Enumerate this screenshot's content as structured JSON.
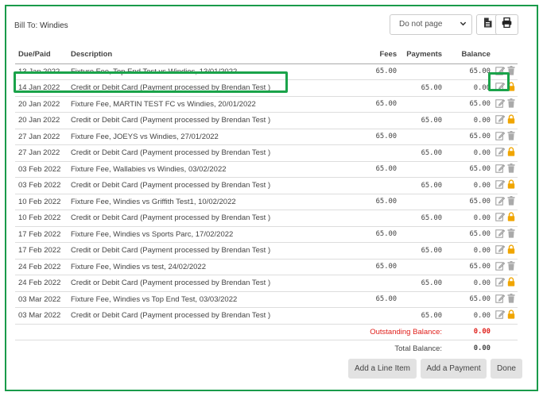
{
  "bill_to": {
    "label": "Bill To:",
    "value": "Windies"
  },
  "paging": {
    "selected": "Do not page"
  },
  "toolbar": {
    "doc_icon": "document-icon",
    "print_icon": "print-icon"
  },
  "table": {
    "headers": {
      "due_paid": "Due/Paid",
      "description": "Description",
      "fees": "Fees",
      "payments": "Payments",
      "balance": "Balance"
    },
    "rows": [
      {
        "date": "13 Jan 2022",
        "description": "Fixture Fee, Top End Test vs Windies, 13/01/2022",
        "fees": "65.00",
        "payments": "",
        "balance": "65.00",
        "type": "fee"
      },
      {
        "date": "14 Jan 2022",
        "description": "Credit or Debit Card (Payment processed by Brendan Test )",
        "fees": "",
        "payments": "65.00",
        "balance": "0.00",
        "type": "payment"
      },
      {
        "date": "20 Jan 2022",
        "description": "Fixture Fee, MARTIN TEST FC vs Windies, 20/01/2022",
        "fees": "65.00",
        "payments": "",
        "balance": "65.00",
        "type": "fee"
      },
      {
        "date": "20 Jan 2022",
        "description": "Credit or Debit Card (Payment processed by Brendan Test )",
        "fees": "",
        "payments": "65.00",
        "balance": "0.00",
        "type": "payment"
      },
      {
        "date": "27 Jan 2022",
        "description": "Fixture Fee, JOEYS vs Windies, 27/01/2022",
        "fees": "65.00",
        "payments": "",
        "balance": "65.00",
        "type": "fee"
      },
      {
        "date": "27 Jan 2022",
        "description": "Credit or Debit Card (Payment processed by Brendan Test )",
        "fees": "",
        "payments": "65.00",
        "balance": "0.00",
        "type": "payment"
      },
      {
        "date": "03 Feb 2022",
        "description": "Fixture Fee, Wallabies vs Windies, 03/02/2022",
        "fees": "65.00",
        "payments": "",
        "balance": "65.00",
        "type": "fee"
      },
      {
        "date": "03 Feb 2022",
        "description": "Credit or Debit Card (Payment processed by Brendan Test )",
        "fees": "",
        "payments": "65.00",
        "balance": "0.00",
        "type": "payment"
      },
      {
        "date": "10 Feb 2022",
        "description": "Fixture Fee, Windies vs Griffith Test1, 10/02/2022",
        "fees": "65.00",
        "payments": "",
        "balance": "65.00",
        "type": "fee"
      },
      {
        "date": "10 Feb 2022",
        "description": "Credit or Debit Card (Payment processed by Brendan Test )",
        "fees": "",
        "payments": "65.00",
        "balance": "0.00",
        "type": "payment"
      },
      {
        "date": "17 Feb 2022",
        "description": "Fixture Fee, Windies vs Sports Parc, 17/02/2022",
        "fees": "65.00",
        "payments": "",
        "balance": "65.00",
        "type": "fee"
      },
      {
        "date": "17 Feb 2022",
        "description": "Credit or Debit Card (Payment processed by Brendan Test )",
        "fees": "",
        "payments": "65.00",
        "balance": "0.00",
        "type": "payment"
      },
      {
        "date": "24 Feb 2022",
        "description": "Fixture Fee, Windies vs test, 24/02/2022",
        "fees": "65.00",
        "payments": "",
        "balance": "65.00",
        "type": "fee"
      },
      {
        "date": "24 Feb 2022",
        "description": "Credit or Debit Card (Payment processed by Brendan Test )",
        "fees": "",
        "payments": "65.00",
        "balance": "0.00",
        "type": "payment"
      },
      {
        "date": "03 Mar 2022",
        "description": "Fixture Fee, Windies vs Top End Test, 03/03/2022",
        "fees": "65.00",
        "payments": "",
        "balance": "65.00",
        "type": "fee"
      },
      {
        "date": "03 Mar 2022",
        "description": "Credit or Debit Card (Payment processed by Brendan Test )",
        "fees": "",
        "payments": "65.00",
        "balance": "0.00",
        "type": "payment"
      }
    ],
    "outstanding": {
      "label": "Outstanding Balance:",
      "value": "0.00"
    },
    "total": {
      "label": "Total Balance:",
      "value": "0.00"
    }
  },
  "buttons": {
    "add_line_item": "Add a Line Item",
    "add_payment": "Add a Payment",
    "done": "Done"
  },
  "colors": {
    "highlight": "#1aa34a",
    "outstanding": "#e0201b",
    "lock": "#f0a500",
    "button_bg": "#e2e2e2"
  }
}
